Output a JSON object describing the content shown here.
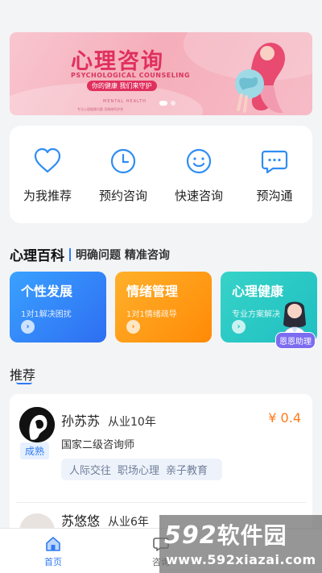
{
  "banner": {
    "title": "心理咨询",
    "subtitle": "PSYCHOLOGICAL COUNSELING",
    "tagline": "你的健康  我们来守护",
    "small_text": "MENTAL HEALTH",
    "tiny_text": "专注心理健康问题  用情感呵护你"
  },
  "quick_menu": [
    {
      "label": "为我推荐",
      "icon": "heart-icon"
    },
    {
      "label": "预约咨询",
      "icon": "clock-icon"
    },
    {
      "label": "快速咨询",
      "icon": "smile-icon"
    },
    {
      "label": "预沟通",
      "icon": "chat-icon"
    }
  ],
  "encyclopedia": {
    "title": "心理百科",
    "subtitle": "明确问题 精准咨询",
    "cards": [
      {
        "title": "个性发展",
        "sub": "1对1解决困扰",
        "color": "#2e6ef2"
      },
      {
        "title": "情绪管理",
        "sub": "1对1情绪疏导",
        "color": "#ff8a06"
      },
      {
        "title": "心理健康",
        "sub": "专业方案解决",
        "color": "#1fbfc2"
      }
    ],
    "assistant_label": "恩恩助理"
  },
  "recommend": {
    "title": "推荐",
    "items": [
      {
        "name": "孙苏苏",
        "years": "从业10年",
        "price": "¥ 0.4",
        "level": "成熟",
        "cert": "国家二级咨询师",
        "tags": [
          "人际交往",
          "职场心理",
          "亲子教育"
        ]
      },
      {
        "name": "苏悠悠",
        "years": "从业6年"
      }
    ]
  },
  "bottom_nav": [
    {
      "label": "首页",
      "icon": "home-icon",
      "active": true
    },
    {
      "label": "咨询",
      "icon": "chat-icon",
      "active": false
    }
  ],
  "watermark": {
    "brand_num": "592",
    "brand_cn": "软件园",
    "url": "www.592xiazai.com"
  },
  "colors": {
    "accent": "#2f7bf2",
    "price": "#ff7a1a"
  }
}
